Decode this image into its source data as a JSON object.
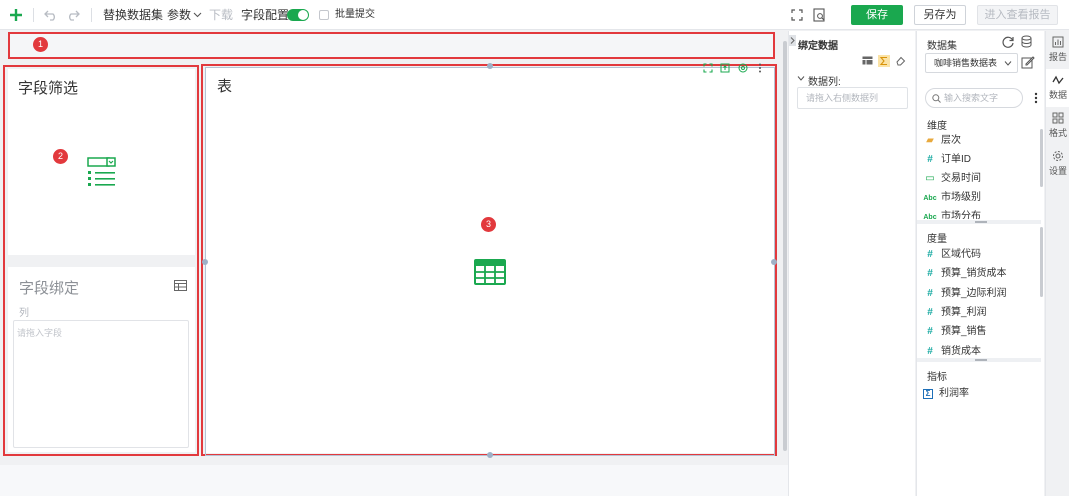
{
  "toolbar": {
    "replace_dataset": "替换数据集",
    "params": "参数",
    "download": "下载",
    "field_config": "字段配置",
    "batch_submit": "批量提交",
    "save": "保存",
    "save_as": "另存为",
    "enter_view": "进入查看报告",
    "colors": {
      "accent": "#1aa84f"
    },
    "icons": [
      "add-icon",
      "undo-icon",
      "redo-icon",
      "chevron-down-icon",
      "fullscreen-icon",
      "preview-icon"
    ]
  },
  "canvas": {
    "badges": [
      "1",
      "2",
      "3"
    ],
    "filter_card": {
      "title": "字段筛选"
    },
    "bind_card": {
      "title": "字段绑定",
      "col_label": "列",
      "drop_placeholder": "请拖入字段"
    },
    "table_card": {
      "title": "表"
    },
    "colors": {
      "highlight": "#e2393d"
    }
  },
  "binding_panel": {
    "title": "绑定数据",
    "data_col_label": "数据列:",
    "drop_placeholder": "请拖入右侧数据列"
  },
  "dataset_panel": {
    "title": "数据集",
    "selected": "咖啡销售数据表",
    "search_placeholder": "输入搜索文字",
    "dimension_label": "维度",
    "dimensions": [
      "层次",
      "订单ID",
      "交易时间",
      "市场级别",
      "市场分布"
    ],
    "measure_label": "度量",
    "measures": [
      "区域代码",
      "预算_销货成本",
      "预算_边际利润",
      "预算_利润",
      "预算_销售",
      "销货成本"
    ],
    "indicator_label": "指标",
    "indicators": [
      "利润率"
    ]
  },
  "rail": {
    "items": [
      "报告",
      "数据",
      "格式",
      "设置"
    ]
  }
}
